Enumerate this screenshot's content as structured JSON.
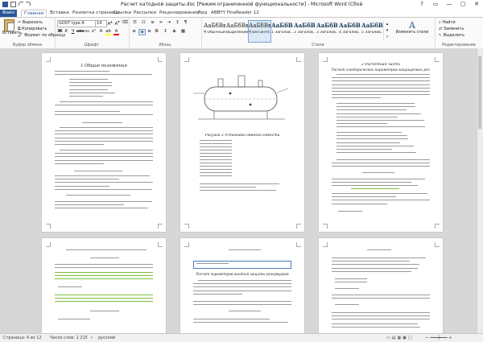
{
  "window": {
    "title": "Расчет катодной защиты.doc [Режим ограниченной функциональности] - Microsoft Word (Сбой активации продукта)",
    "controls": [
      "?",
      "▭",
      "—",
      "▢",
      "✕"
    ]
  },
  "tabs": {
    "file": "Файл",
    "items": [
      "Главная",
      "Вставка",
      "Разметка страницы",
      "Ссылки",
      "Рассылки",
      "Рецензирование",
      "Вид",
      "ABBYY FineReader 12"
    ]
  },
  "ribbon": {
    "clipboard": {
      "paste": "Вставить",
      "cut": "Вырезать",
      "copy": "Копировать",
      "format_painter": "Формат по образцу",
      "label": "Буфер обмена"
    },
    "font": {
      "name": "GOST type A",
      "size": "14",
      "label": "Шрифт"
    },
    "paragraph": {
      "label": "Абзац"
    },
    "styles": {
      "items": [
        {
          "sample": "АаБбВвГ",
          "name": "¶ Обычный"
        },
        {
          "sample": "АаБбВв",
          "name": "Выделение"
        },
        {
          "sample": "АаБбВвГ",
          "name": "¶ Без инте..."
        },
        {
          "sample": "АаБбВв",
          "name": "1 Заголов..."
        },
        {
          "sample": "АаБбВв",
          "name": "2 Заголов..."
        },
        {
          "sample": "АаБбВв",
          "name": "3 Заголов..."
        },
        {
          "sample": "АаБбВв",
          "name": "4 Заголов..."
        },
        {
          "sample": "АаБбВв",
          "name": "5 Заголов..."
        }
      ],
      "change": "Изменить стили",
      "label": "Стили"
    },
    "editing": {
      "find": "Найти",
      "replace": "Заменить",
      "select": "Выделить",
      "label": "Редактирование"
    }
  },
  "pages": {
    "p1_title": "1 Общие положения",
    "p2_caption": "Рисунок 2 Установка обвязки емкости",
    "p3_heading": "2 Расчетная часть",
    "p3_sub": "Расчет электрических параметров защищаемых резервуаров",
    "p5_heading": "Расчет параметров анодной защиты резервуаров"
  },
  "status": {
    "page": "Страница: 4 из 12",
    "words": "Число слов: 1 215",
    "lang": "русский"
  },
  "colors": {
    "accent": "#2b579a",
    "highlight_green": "#7cbf3c",
    "highlight_box": "#4a78c0"
  }
}
